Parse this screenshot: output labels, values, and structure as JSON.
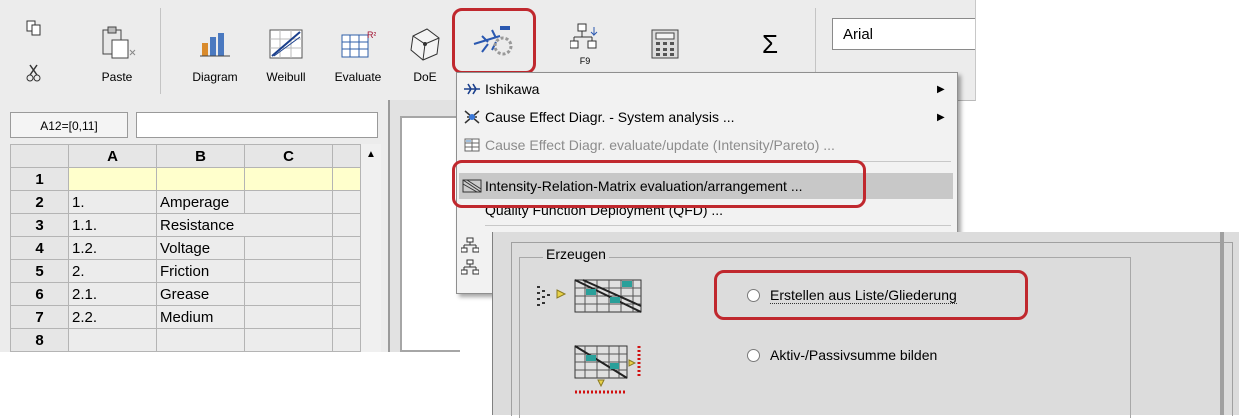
{
  "toolbar": {
    "paste_label": "Paste",
    "diagram_label": "Diagram",
    "weibull_label": "Weibull",
    "evaluate_label": "Evaluate",
    "doe_label": "DoE",
    "f9_label": "F9",
    "font_value": "Arial",
    "r2_label": "R²",
    "sigma_label": "Σ",
    "highlight_color": "#c0282e"
  },
  "sheet": {
    "cell_ref": "A12=[0,11]",
    "columns": [
      "A",
      "B",
      "C"
    ],
    "rows": [
      {
        "num": "1",
        "a": "",
        "b": ""
      },
      {
        "num": "2",
        "a": "1.",
        "b": "Amperage"
      },
      {
        "num": "3",
        "a": "1.1.",
        "b": "Resistance"
      },
      {
        "num": "4",
        "a": "1.2.",
        "b": "Voltage"
      },
      {
        "num": "5",
        "a": "2.",
        "b": "Friction"
      },
      {
        "num": "6",
        "a": "2.1.",
        "b": "Grease"
      },
      {
        "num": "7",
        "a": "2.2.",
        "b": "Medium"
      },
      {
        "num": "8",
        "a": "",
        "b": ""
      }
    ]
  },
  "menu": {
    "items": [
      {
        "label": "Ishikawa",
        "submenu": true,
        "icon": "ishikawa-icon"
      },
      {
        "label": "Cause Effect Diagr. - System analysis ...",
        "submenu": true,
        "icon": "cause-effect-icon"
      },
      {
        "label": "Cause Effect Diagr. evaluate/update (Intensity/Pareto) ...",
        "disabled": true,
        "icon": "evaluate-grid-icon"
      },
      {
        "label": "Intensity-Relation-Matrix evaluation/arrangement ...",
        "selected": true,
        "icon": "matrix-icon"
      },
      {
        "label": "Quality Function Deployment (QFD) ...",
        "icon": ""
      }
    ]
  },
  "dialog": {
    "group_title": "Erzeugen",
    "option1": "Erstellen aus Liste/Gliederung",
    "option2": "Aktiv-/Passivsumme bilden"
  }
}
